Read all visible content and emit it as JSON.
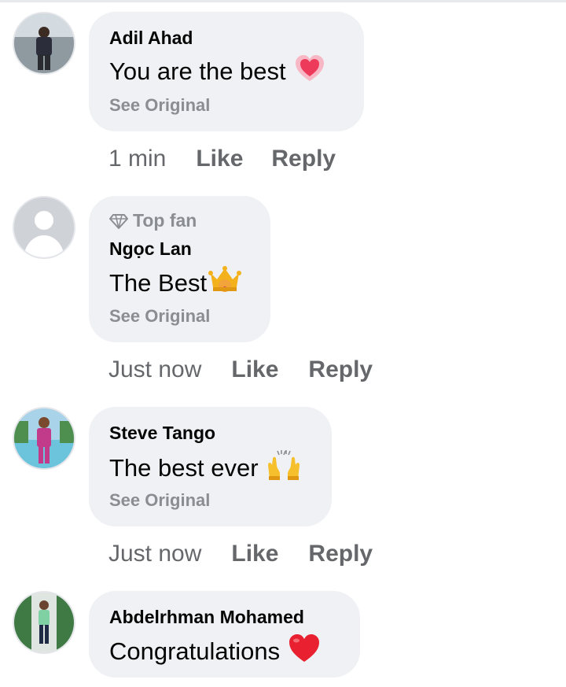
{
  "comments": [
    {
      "author": "Adil Ahad",
      "text": "You are the best",
      "emoji_icon": "heart-emoji",
      "see_original": "See Original",
      "time": "1 min",
      "like": "Like",
      "reply": "Reply"
    },
    {
      "badge": "Top fan",
      "badge_icon": "diamond-icon",
      "author": "Ngọc Lan",
      "text": "The Best",
      "emoji_icon": "crown-emoji",
      "see_original": "See Original",
      "time": "Just now",
      "like": "Like",
      "reply": "Reply"
    },
    {
      "author": "Steve Tango",
      "text": "The best ever",
      "emoji_icon": "raising-hands-emoji",
      "see_original": "See Original",
      "time": "Just now",
      "like": "Like",
      "reply": "Reply"
    },
    {
      "author": "Abdelrhman Mohamed",
      "text": "Congratulations",
      "emoji_icon": "red-heart-emoji"
    }
  ],
  "colors": {
    "bubble": "#f0f1f4",
    "text": "#050505",
    "muted": "#65676b",
    "secondary": "#8a8d91"
  }
}
